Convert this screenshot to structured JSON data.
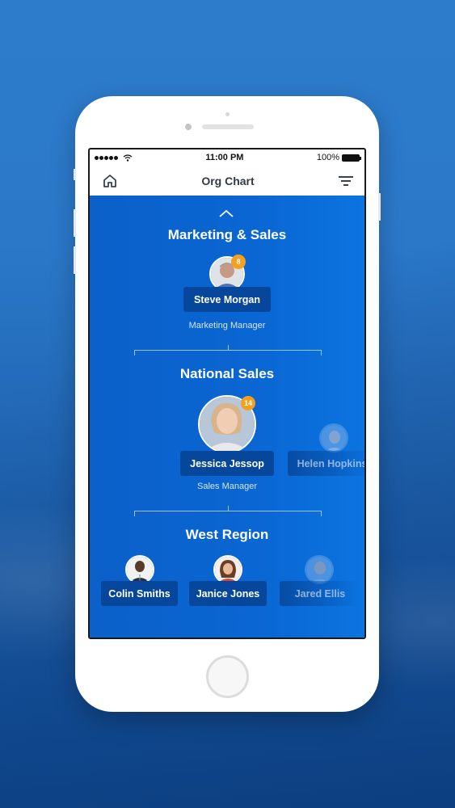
{
  "status_bar": {
    "signal_dots": 5,
    "time": "11:00 PM",
    "battery_percent": "100%"
  },
  "nav": {
    "title": "Org Chart",
    "home_icon": "home-icon",
    "filter_icon": "filter-icon"
  },
  "collapse_icon": "chevron-up-icon",
  "sections": [
    {
      "title": "Marketing & Sales",
      "people": [
        {
          "name": "Steve Morgan",
          "role": "Marketing Manager",
          "badge": "8"
        }
      ]
    },
    {
      "title": "National Sales",
      "people": [
        {
          "name": "Jessica Jessop",
          "role": "Sales Manager",
          "badge": "14"
        },
        {
          "name": "Helen Hopkins"
        }
      ]
    },
    {
      "title": "West Region",
      "people": [
        {
          "name": "Colin Smiths"
        },
        {
          "name": "Janice Jones"
        },
        {
          "name": "Jared Ellis"
        }
      ]
    }
  ],
  "colors": {
    "accent": "#0a66d3",
    "name_chip": "#06479b",
    "badge": "#f5a01f"
  }
}
